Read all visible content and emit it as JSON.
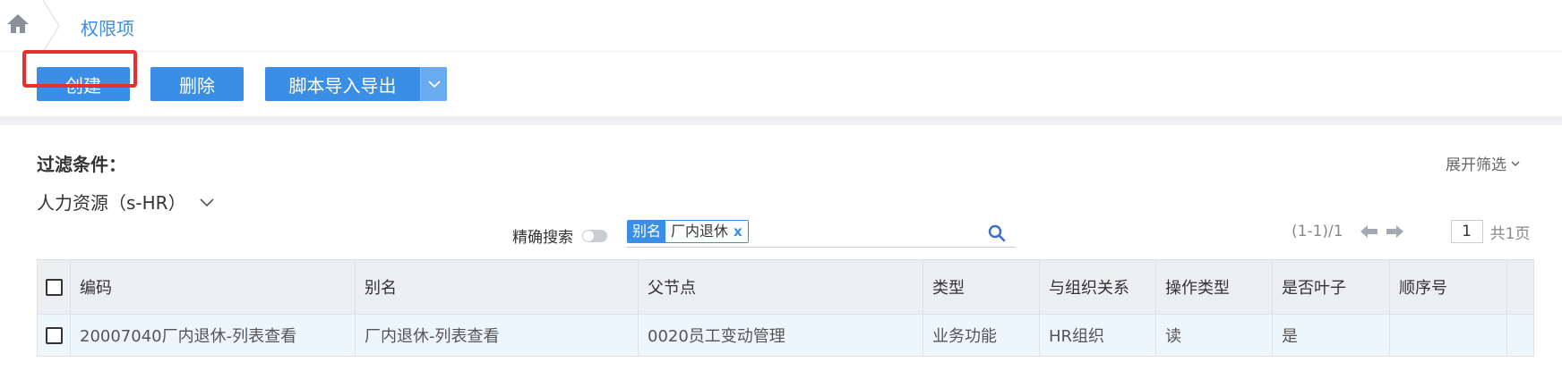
{
  "breadcrumb": {
    "current": "权限项"
  },
  "toolbar": {
    "create_label": "创建",
    "delete_label": "删除",
    "script_label": "脚本导入导出"
  },
  "filter": {
    "title": "过滤条件：",
    "expand_label": "展开筛选",
    "department": "人力资源（s-HR）",
    "exact_search_label": "精确搜索",
    "tag_key": "别名",
    "tag_value": "厂内退休",
    "tag_remove": "x"
  },
  "pager": {
    "range": "(1-1)/1",
    "page": "1",
    "total": "共1页"
  },
  "table": {
    "headers": [
      "编码",
      "别名",
      "父节点",
      "类型",
      "与组织关系",
      "操作类型",
      "是否叶子",
      "顺序号"
    ],
    "rows": [
      [
        "20007040厂内退休-列表查看",
        "厂内退休-列表查看",
        "0020员工变动管理",
        "业务功能",
        "HR组织",
        "读",
        "是",
        ""
      ]
    ]
  },
  "colors": {
    "accent": "#3a8ee6",
    "highlight": "#e8312f"
  }
}
